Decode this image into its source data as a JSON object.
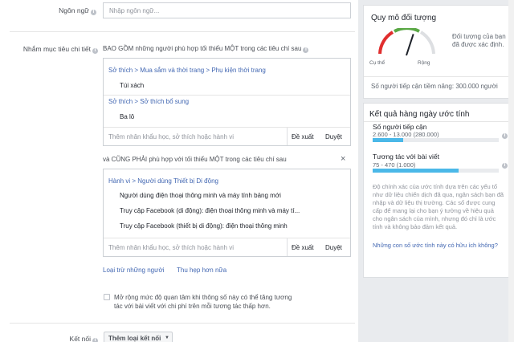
{
  "language": {
    "label": "Ngôn ngữ",
    "placeholder": "Nhập ngôn ngữ..."
  },
  "targeting": {
    "label": "Nhắm mục tiêu chi tiết",
    "include_text": "BAO GỒM những người phù hợp tối thiểu MỘT trong các tiêu chí sau",
    "group1": {
      "path1": "Sở thích > Mua sắm và thời trang > Phụ kiện thời trang",
      "item1": "Túi xách",
      "path2": "Sở thích > Sở thích bổ sung",
      "item2": "Ba lô",
      "input_placeholder": "Thêm nhân khẩu học, sở thích hoặc hành vi",
      "suggest": "Đề xuất",
      "browse": "Duyệt"
    },
    "must_text": "và CŨNG PHẢI phù hợp với tối thiểu MỘT trong các tiêu chí sau",
    "close_symbol": "×",
    "group2": {
      "path": "Hành vi > Người dùng Thiết bị Di động",
      "items": [
        "Người dùng điện thoại thông minh và máy tính bảng mới",
        "Truy cập Facebook (di động): điện thoại thông minh và máy tí...",
        "Truy cập Facebook (thiết bị di động): điện thoại thông minh"
      ],
      "input_placeholder": "Thêm nhân khẩu học, sở thích hoặc hành vi",
      "suggest": "Đề xuất",
      "browse": "Duyệt"
    },
    "exclude": "Loại trừ những người",
    "narrow": "Thu hẹp hơn nữa",
    "expand_text": "Mở rộng mức độ quan tâm khi thông số này có thể tăng tương tác với bài viết với chi phí trên mỗi tương tác thấp hơn.",
    "expand_checked": false
  },
  "connections": {
    "label": "Kết nối",
    "button": "Thêm loại kết nối"
  },
  "audience": {
    "title": "Quy mô đối tượng",
    "specific": "Cụ thể",
    "broad": "Rộng",
    "desc": "Đối tượng của bạn đã được xác định.",
    "reach": "Số người tiếp cận tiềm năng: 300.000 người",
    "gauge_level": 0.6
  },
  "daily": {
    "title": "Kết quả hàng ngày ước tính",
    "reach_label": "Số người tiếp cận",
    "reach_value": "2.600 - 13.000 (280.000)",
    "reach_fraction": 0.24,
    "eng_label": "Tương tác với bài viết",
    "eng_value": "75 - 470 (1.000)",
    "eng_fraction": 0.68,
    "note": "Độ chính xác của ước tính dựa trên các yếu tố như dữ liệu chiến dịch đã qua, ngân sách bạn đã nhập và dữ liệu thị trường. Các số được cung cấp để mang lại cho bạn ý tưởng về hiệu quả cho ngân sách của mình, nhưng đó chỉ là ước tính và không bảo đảm kết quả.",
    "question": "Những con số ước tính này có hữu ích không?"
  },
  "colors": {
    "link": "#4267b2",
    "bar": "#4bb8e8",
    "gauge_red": "#e02e2e",
    "gauge_green": "#5aa845"
  }
}
